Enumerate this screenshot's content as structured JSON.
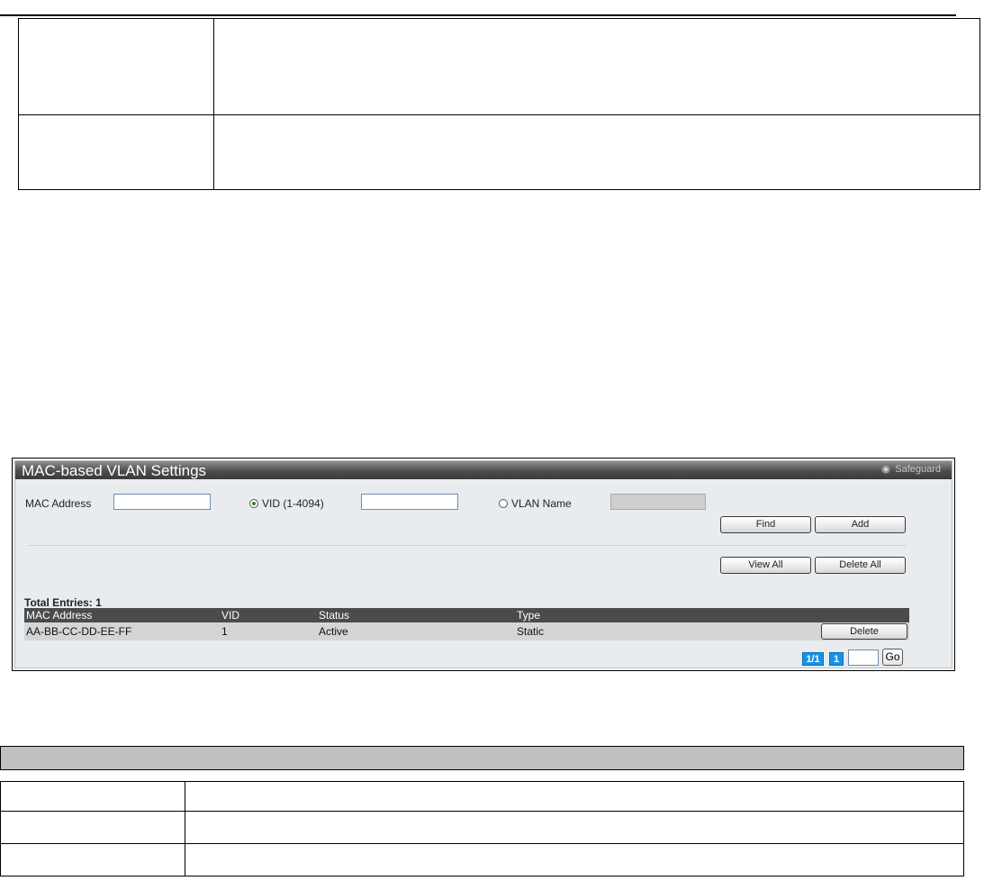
{
  "panel": {
    "title": "MAC-based VLAN Settings",
    "safeguard_label": "Safeguard",
    "mac_address_label": "MAC Address",
    "mac_address_value": "",
    "vid_label": "VID (1-4094)",
    "vid_value": "",
    "vlan_name_label": "VLAN Name",
    "vlan_name_value": "",
    "selected_radio": "vid",
    "buttons": {
      "find": "Find",
      "add": "Add",
      "view_all": "View All",
      "delete_all": "Delete All"
    },
    "total_entries_label": "Total Entries: 1",
    "table": {
      "headers": [
        "MAC Address",
        "VID",
        "Status",
        "Type"
      ],
      "rows": [
        {
          "mac": "AA-BB-CC-DD-EE-FF",
          "vid": "1",
          "status": "Active",
          "type": "Static",
          "action": "Delete"
        }
      ]
    },
    "pagination": {
      "page_of": "1/1",
      "current_page": "1",
      "go_label": "Go"
    }
  },
  "colors": {
    "title_bar": "#4d4d4d",
    "panel_bg": "#e8ecef",
    "table_header": "#4b4b4b",
    "row_bg": "#d5d5d5",
    "pagination": "#1593e8",
    "doc_header_band": "#c0c0c0"
  }
}
